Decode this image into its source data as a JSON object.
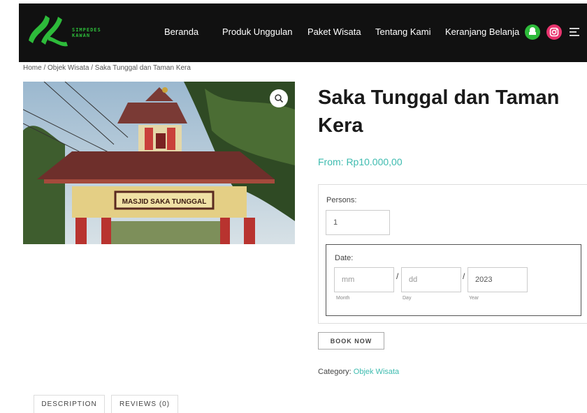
{
  "header": {
    "logo_text_line1": "SIMPEDES",
    "logo_text_line2": "KAWAN",
    "nav": [
      "Beranda",
      "Produk Unggulan",
      "Paket Wisata",
      "Tentang Kami",
      "Keranjang Belanja"
    ],
    "icons": [
      "chat-icon",
      "instagram-icon",
      "menu-icon"
    ],
    "colors": {
      "bg": "#111111",
      "brand_green": "#2dbb3a",
      "instagram": "#e8336d",
      "chat_green": "#2dbb3a"
    }
  },
  "breadcrumb": "Home / Objek Wisata / Saka Tunggal dan Taman Kera",
  "product": {
    "image_sign_text": "MASJID SAKA TUNGGAL",
    "title": "Saka Tunggal dan Taman Kera",
    "price": "From: Rp10.000,00",
    "accent": "#3dbbaf"
  },
  "form": {
    "persons_label": "Persons:",
    "persons_value": "1",
    "date_label": "Date:",
    "month_placeholder": "mm",
    "day_placeholder": "dd",
    "year_value": "2023",
    "month_caption": "Month",
    "day_caption": "Day",
    "year_caption": "Year",
    "separator": "/",
    "book_button": "BOOK NOW"
  },
  "category": {
    "label": "Category:",
    "value": "Objek Wisata"
  },
  "tabs": [
    "DESCRIPTION",
    "REVIEWS (0)"
  ]
}
